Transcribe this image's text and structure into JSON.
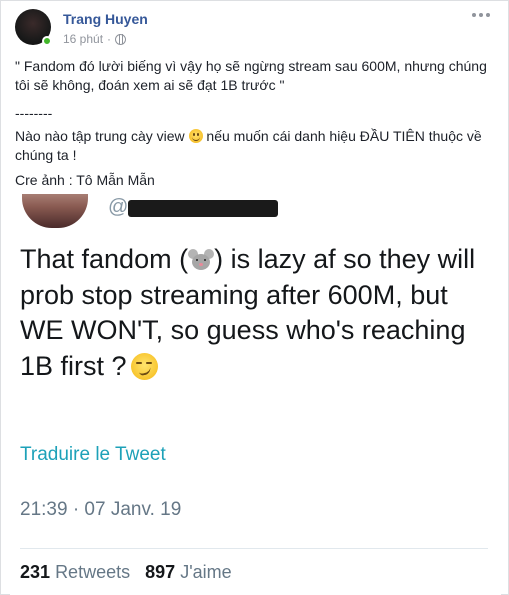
{
  "post": {
    "author": "Trang Huyen",
    "time": "16 phút",
    "separator": "·",
    "body": {
      "line1": "\" Fandom đó lười biếng vì vậy họ sẽ ngừng stream sau 600M, nhưng chúng tôi sẽ không, đoán xem ai sẽ đạt 1B trước \"",
      "divider": "--------",
      "line2_before": "Nào nào tập trung cày view ",
      "line2_after": " nếu muốn cái danh hiệu ĐẦU TIÊN thuộc về chúng ta !",
      "credit": "Cre ảnh : Tô Mẫn Mẫn"
    }
  },
  "tweet": {
    "handle_prefix": "@",
    "text_part1": "That fandom (",
    "text_part2": ") is lazy af so they  will prob stop streaming after 600M, but WE WON'T, so guess who's reaching 1B first ?",
    "translate_label": "Traduire le Tweet",
    "date": "21:39 · 07 Janv. 19",
    "retweets_count": "231",
    "retweets_label": "Retweets",
    "likes_count": "897",
    "likes_label": "J'aime"
  },
  "icons": {
    "globe": "globe-icon",
    "more": "more-options-icon",
    "smile": "smile-emoji-icon",
    "mouse": "mouse-emoji-icon",
    "smirk": "smirk-emoji-icon"
  },
  "colors": {
    "author_link": "#365899",
    "meta_text": "#90949c",
    "online_dot": "#42b72a",
    "tweet_link": "#1da1b8"
  }
}
